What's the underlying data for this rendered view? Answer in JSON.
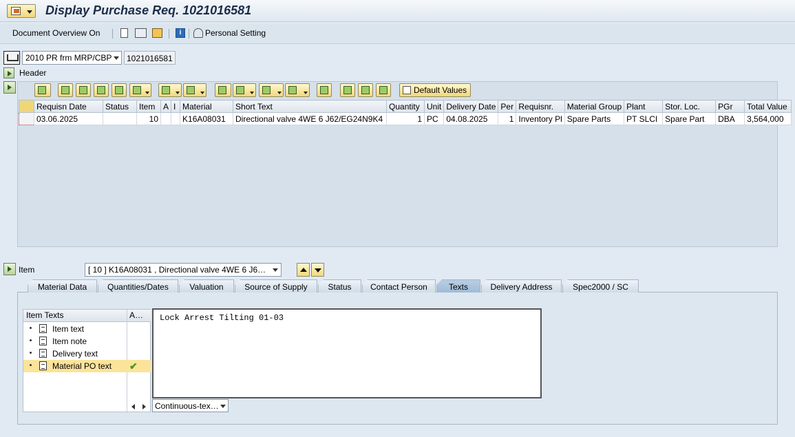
{
  "title": "Display Purchase Req. 1021016581",
  "toolbar": {
    "doc_overview": "Document Overview On",
    "personal_setting": "Personal Setting",
    "info_glyph": "i"
  },
  "selection": {
    "doc_type": "2010 PR frm MRP/CBP",
    "pr_number": "1021016581"
  },
  "header": {
    "label": "Header"
  },
  "grid_tools": {
    "default_values": "Default Values"
  },
  "grid": {
    "columns": [
      "Requisn Date",
      "Status",
      "Item",
      "A",
      "I",
      "Material",
      "Short Text",
      "Quantity",
      "Unit",
      "Delivery Date",
      "Per",
      "Requisnr.",
      "Material Group",
      "Plant",
      "Stor. Loc.",
      "PGr",
      "Total Value"
    ],
    "rows": [
      {
        "requisn_date": "03.06.2025",
        "status": "",
        "item": "10",
        "a": "",
        "i": "",
        "material": "K16A08031",
        "short_text": "Directional valve 4WE 6 J62/EG24N9K4",
        "quantity": "1",
        "unit": "PC",
        "delivery_date": "04.08.2025",
        "per": "1",
        "requisnr": "Inventory Pl",
        "material_group": "Spare Parts",
        "plant": "PT SLCI",
        "stor_loc": "Spare Part",
        "pgr": "DBA",
        "total_value": "3,564,000"
      }
    ]
  },
  "item": {
    "label": "Item",
    "selected": "[ 10 ] K16A08031 , Directional valve 4WE 6 J6…"
  },
  "tabs": [
    "Material Data",
    "Quantities/Dates",
    "Valuation",
    "Source of Supply",
    "Status",
    "Contact Person",
    "Texts",
    "Delivery Address",
    "Spec2000 / SC"
  ],
  "active_tab": "Texts",
  "texts": {
    "tree_header": "Item Texts",
    "col2_header": "A…",
    "items": [
      "Item text",
      "Item note",
      "Delivery text",
      "Material PO text"
    ],
    "selected": "Material PO text",
    "check_glyph": "✔",
    "editor_content": "Lock Arrest Tilting 01-03",
    "mode": "Continuous-tex…"
  }
}
